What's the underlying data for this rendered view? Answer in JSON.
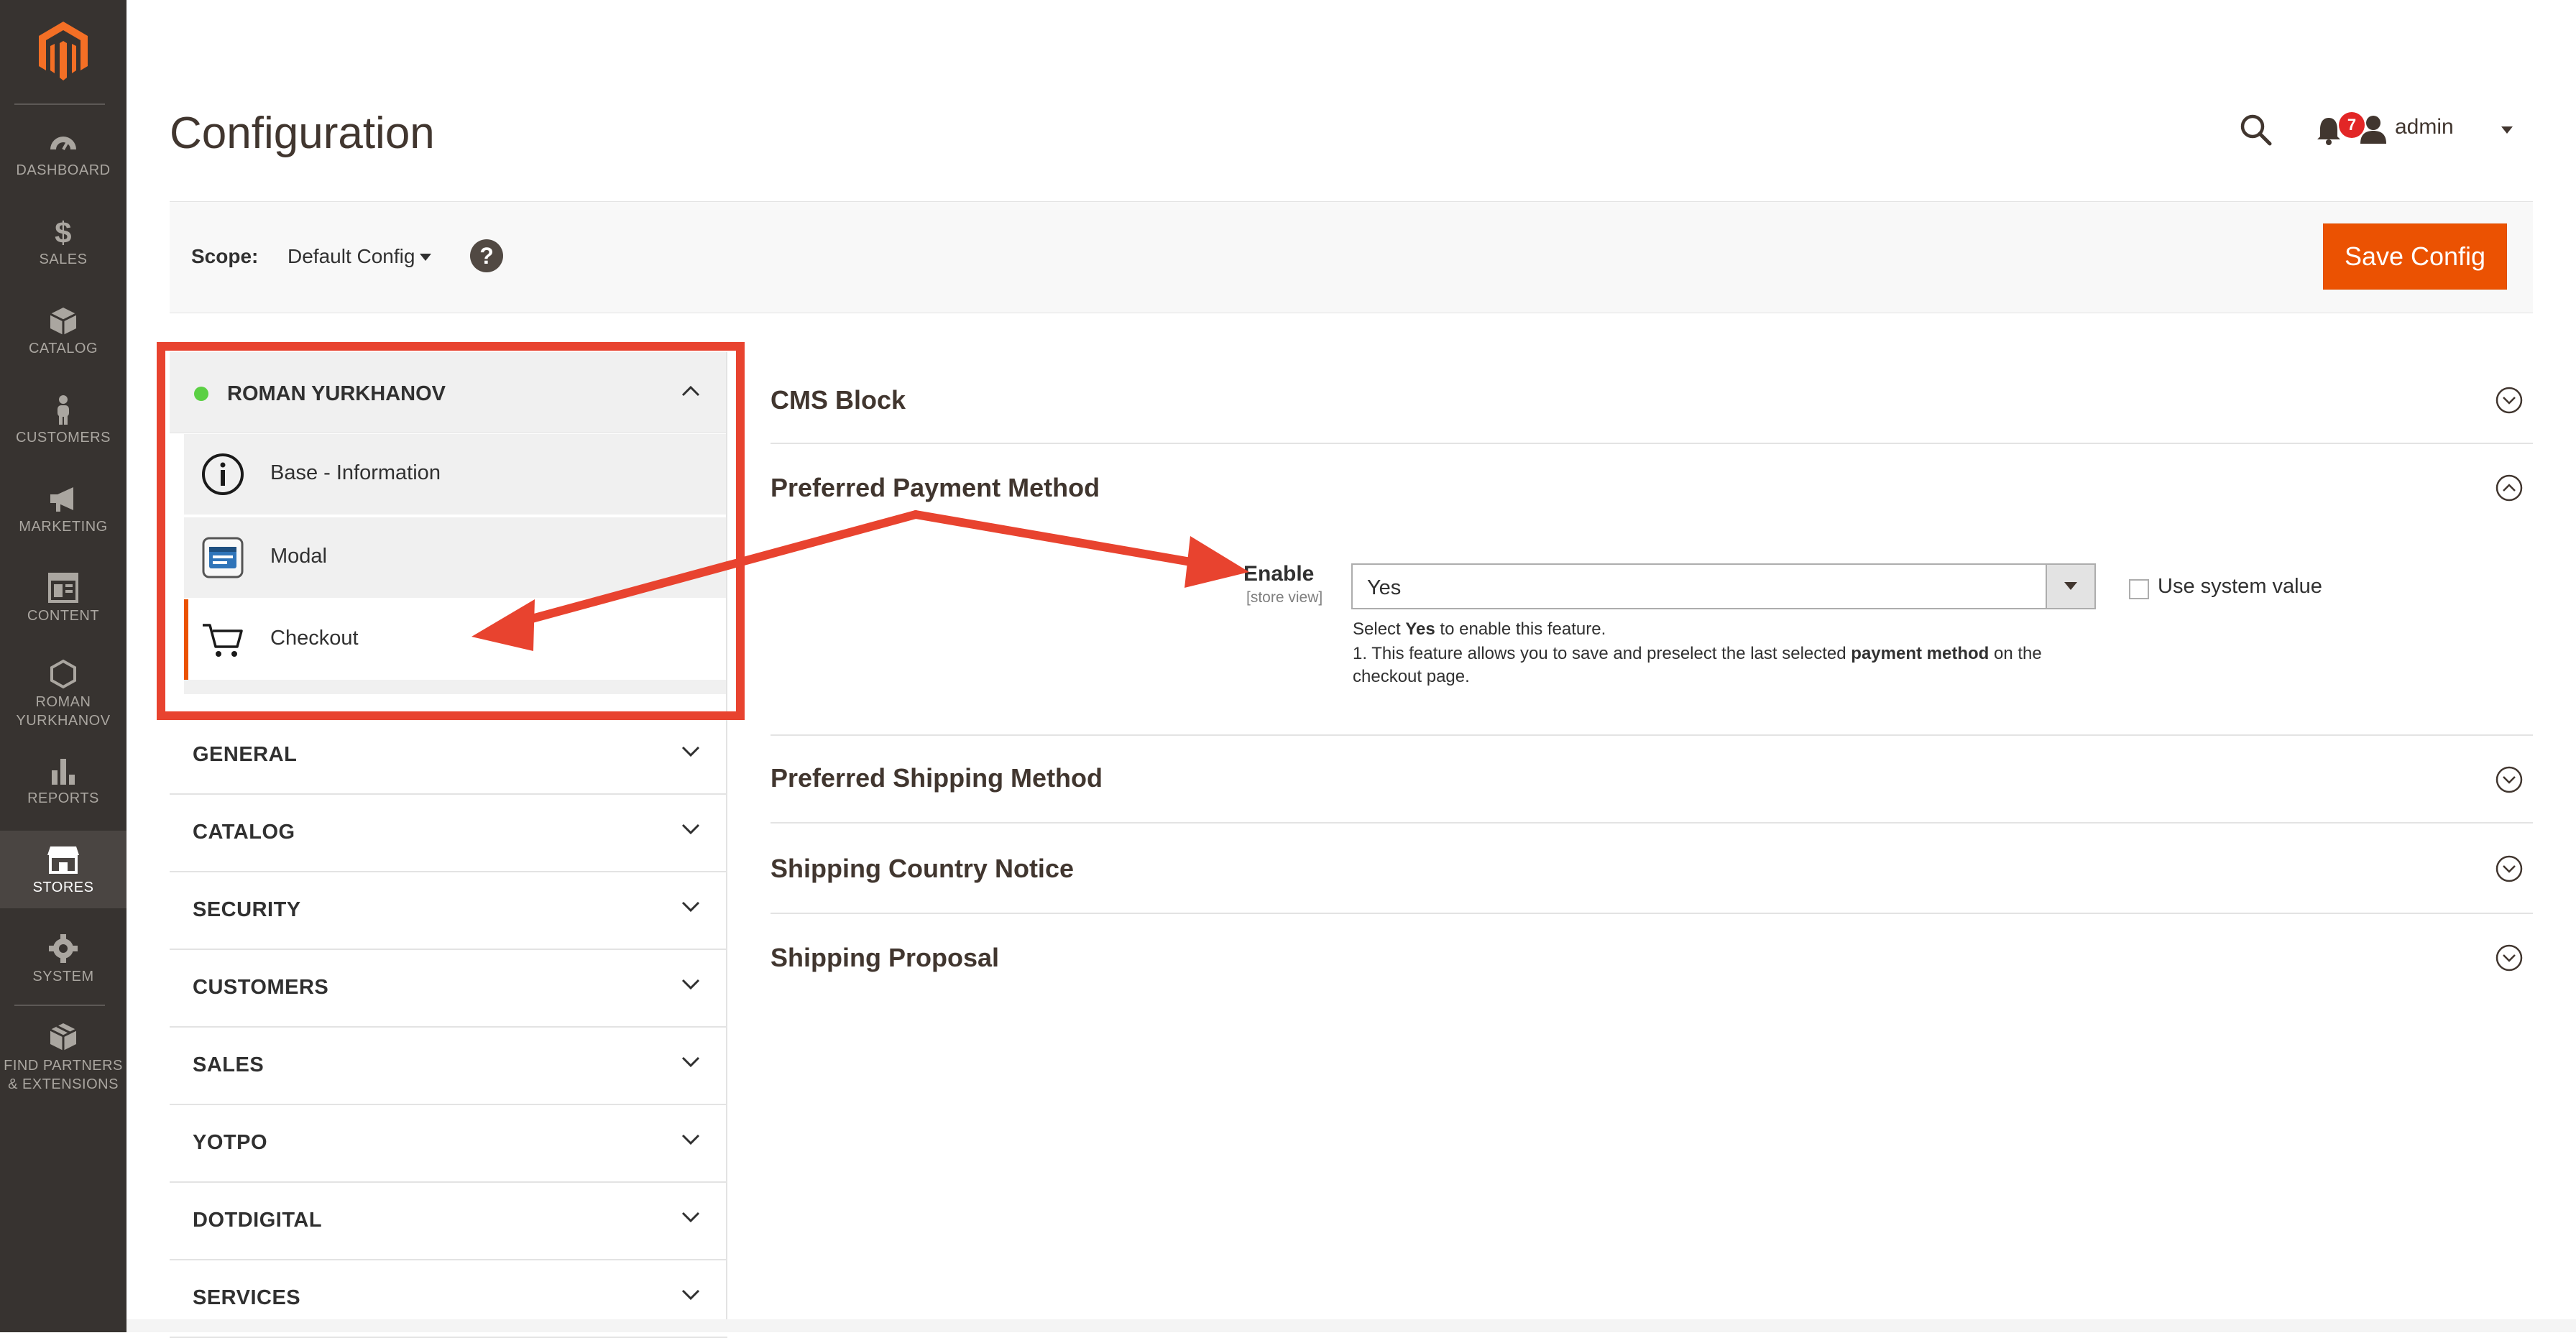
{
  "admin_menu": {
    "items": [
      {
        "label": "DASHBOARD",
        "icon": "dashboard-icon"
      },
      {
        "label": "SALES",
        "icon": "dollar-icon"
      },
      {
        "label": "CATALOG",
        "icon": "cube-icon"
      },
      {
        "label": "CUSTOMERS",
        "icon": "person-icon"
      },
      {
        "label": "MARKETING",
        "icon": "megaphone-icon"
      },
      {
        "label": "CONTENT",
        "icon": "content-icon"
      },
      {
        "label_line1": "ROMAN",
        "label_line2": "YURKHANOV",
        "icon": "hexagon-icon"
      },
      {
        "label": "REPORTS",
        "icon": "bar-chart-icon"
      },
      {
        "label": "STORES",
        "icon": "store-icon"
      },
      {
        "label": "SYSTEM",
        "icon": "gear-icon"
      },
      {
        "label_line1": "FIND PARTNERS",
        "label_line2": "& EXTENSIONS",
        "icon": "boxes-icon"
      }
    ],
    "active": "STORES",
    "accent_color": "#eb5202",
    "background_color": "#373330"
  },
  "header": {
    "title": "Configuration",
    "notification_count": "7",
    "user": "admin"
  },
  "scope_bar": {
    "label": "Scope:",
    "value": "Default Config",
    "help": "?",
    "save_button": "Save Config"
  },
  "tabs": {
    "vendor": {
      "title": "ROMAN YURKHANOV",
      "status_color": "#5bd044",
      "items": [
        {
          "label": "Base - Information",
          "icon": "info-icon"
        },
        {
          "label": "Modal",
          "icon": "modal-icon"
        },
        {
          "label": "Checkout",
          "icon": "cart-icon",
          "active": true
        }
      ]
    },
    "groups": [
      "GENERAL",
      "CATALOG",
      "SECURITY",
      "CUSTOMERS",
      "SALES",
      "YOTPO",
      "DOTDIGITAL",
      "SERVICES"
    ]
  },
  "sections": {
    "cms_block": "CMS Block",
    "preferred_payment": {
      "title": "Preferred Payment Method",
      "field_label": "Enable",
      "field_scope": "[store view]",
      "field_value": "Yes",
      "use_system_value": "Use system value",
      "note_1_pre": "Select ",
      "note_1_bold": "Yes",
      "note_1_post": " to enable this feature.",
      "note_2_pre": "1. This feature allows you to save and preselect the last selected ",
      "note_2_bold": "payment method",
      "note_2_post": " on the",
      "note_3": "checkout page."
    },
    "preferred_shipping": "Preferred Shipping Method",
    "shipping_country_notice": "Shipping Country Notice",
    "shipping_proposal": "Shipping Proposal"
  },
  "annotation": {
    "color": "#e8432f"
  }
}
